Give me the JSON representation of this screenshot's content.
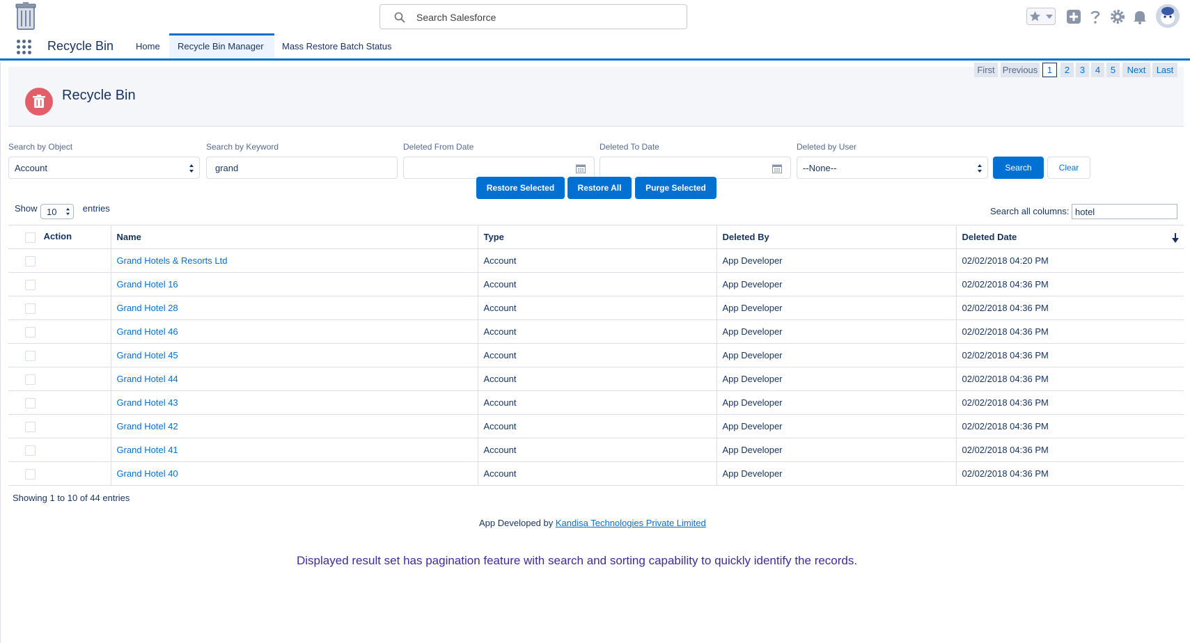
{
  "header": {
    "search_placeholder": "Search Salesforce"
  },
  "nav": {
    "app_name": "Recycle Bin",
    "tabs": [
      {
        "label": "Home"
      },
      {
        "label": "Recycle Bin Manager"
      },
      {
        "label": "Mass Restore Batch Status"
      }
    ]
  },
  "page": {
    "title": "Recycle Bin"
  },
  "filters": {
    "object_label": "Search by Object",
    "object_value": "Account",
    "keyword_label": "Search by Keyword",
    "keyword_value": "grand",
    "from_label": "Deleted From Date",
    "to_label": "Deleted To Date",
    "user_label": "Deleted by User",
    "user_value": "--None--",
    "search_button": "Search",
    "clear_button": "Clear"
  },
  "actions": {
    "restore_selected": "Restore Selected",
    "restore_all": "Restore All",
    "purge_selected": "Purge Selected"
  },
  "table_controls": {
    "show_label": "Show",
    "entries_label": "entries",
    "page_size": "10",
    "search_all_label": "Search all columns:",
    "search_all_value": "hotel"
  },
  "table": {
    "columns": [
      "Action",
      "Name",
      "Type",
      "Deleted By",
      "Deleted Date"
    ],
    "rows": [
      {
        "name": "Grand Hotels & Resorts Ltd",
        "type": "Account",
        "deleted_by": "App Developer",
        "deleted_date": "02/02/2018 04:20 PM"
      },
      {
        "name": "Grand Hotel 16",
        "type": "Account",
        "deleted_by": "App Developer",
        "deleted_date": "02/02/2018 04:36 PM"
      },
      {
        "name": "Grand Hotel 28",
        "type": "Account",
        "deleted_by": "App Developer",
        "deleted_date": "02/02/2018 04:36 PM"
      },
      {
        "name": "Grand Hotel 46",
        "type": "Account",
        "deleted_by": "App Developer",
        "deleted_date": "02/02/2018 04:36 PM"
      },
      {
        "name": "Grand Hotel 45",
        "type": "Account",
        "deleted_by": "App Developer",
        "deleted_date": "02/02/2018 04:36 PM"
      },
      {
        "name": "Grand Hotel 44",
        "type": "Account",
        "deleted_by": "App Developer",
        "deleted_date": "02/02/2018 04:36 PM"
      },
      {
        "name": "Grand Hotel 43",
        "type": "Account",
        "deleted_by": "App Developer",
        "deleted_date": "02/02/2018 04:36 PM"
      },
      {
        "name": "Grand Hotel 42",
        "type": "Account",
        "deleted_by": "App Developer",
        "deleted_date": "02/02/2018 04:36 PM"
      },
      {
        "name": "Grand Hotel 41",
        "type": "Account",
        "deleted_by": "App Developer",
        "deleted_date": "02/02/2018 04:36 PM"
      },
      {
        "name": "Grand Hotel 40",
        "type": "Account",
        "deleted_by": "App Developer",
        "deleted_date": "02/02/2018 04:36 PM"
      }
    ]
  },
  "pagination": {
    "summary": "Showing 1 to 10 of 44 entries",
    "first": "First",
    "previous": "Previous",
    "pages": [
      "1",
      "2",
      "3",
      "4",
      "5"
    ],
    "current_page": "1",
    "next": "Next",
    "last": "Last"
  },
  "footer": {
    "credit_prefix": "App Developed by",
    "credit_link": "Kandisa Technologies Private Limited",
    "caption": "Displayed result set has pagination feature with search and sorting capability to quickly identify the records."
  },
  "icons": {
    "logo": "recycle-bin-logo-icon",
    "search": "search-icon",
    "favorites": "star-icon",
    "add": "plus-icon",
    "help": "question-icon",
    "setup": "gear-icon",
    "notifications": "bell-icon",
    "avatar": "user-avatar-icon",
    "waffle": "app-launcher-icon",
    "page": "trash-icon",
    "calendar": "calendar-icon",
    "sort": "sort-down-icon"
  },
  "colors": {
    "brand": "#0070d2",
    "page_icon": "#e25f6a",
    "caption": "#3c2b9b"
  }
}
